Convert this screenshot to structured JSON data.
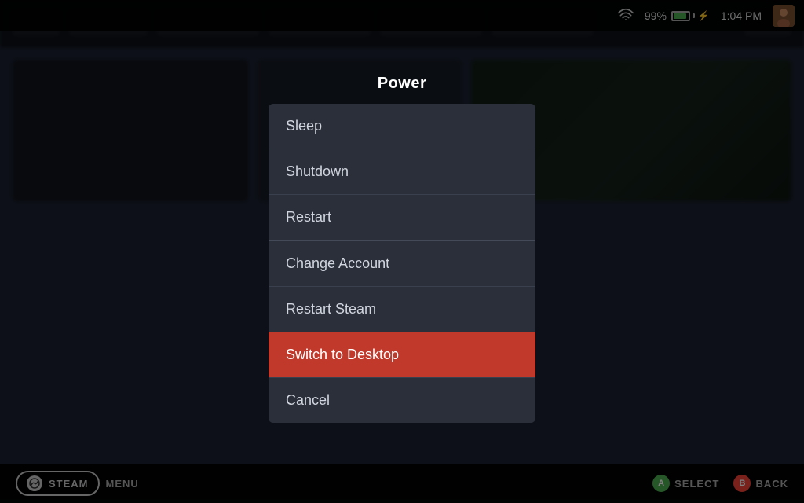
{
  "system_bar": {
    "battery_percent": "99%",
    "time": "1:04 PM"
  },
  "power_dialog": {
    "title": "Power",
    "items": [
      {
        "id": "sleep",
        "label": "Sleep",
        "active": false,
        "section": "top"
      },
      {
        "id": "shutdown",
        "label": "Shutdown",
        "active": false,
        "section": "top"
      },
      {
        "id": "restart",
        "label": "Restart",
        "active": false,
        "section": "top"
      },
      {
        "id": "change-account",
        "label": "Change Account",
        "active": false,
        "section": "bottom"
      },
      {
        "id": "restart-steam",
        "label": "Restart Steam",
        "active": false,
        "section": "bottom"
      },
      {
        "id": "switch-desktop",
        "label": "Switch to Desktop",
        "active": true,
        "section": "bottom"
      },
      {
        "id": "cancel",
        "label": "Cancel",
        "active": false,
        "section": "bottom"
      }
    ]
  },
  "bottom_bar": {
    "steam_label": "STEAM",
    "menu_label": "MENU",
    "select_label": "SELECT",
    "back_label": "BACK",
    "a_btn": "A",
    "b_btn": "B"
  }
}
